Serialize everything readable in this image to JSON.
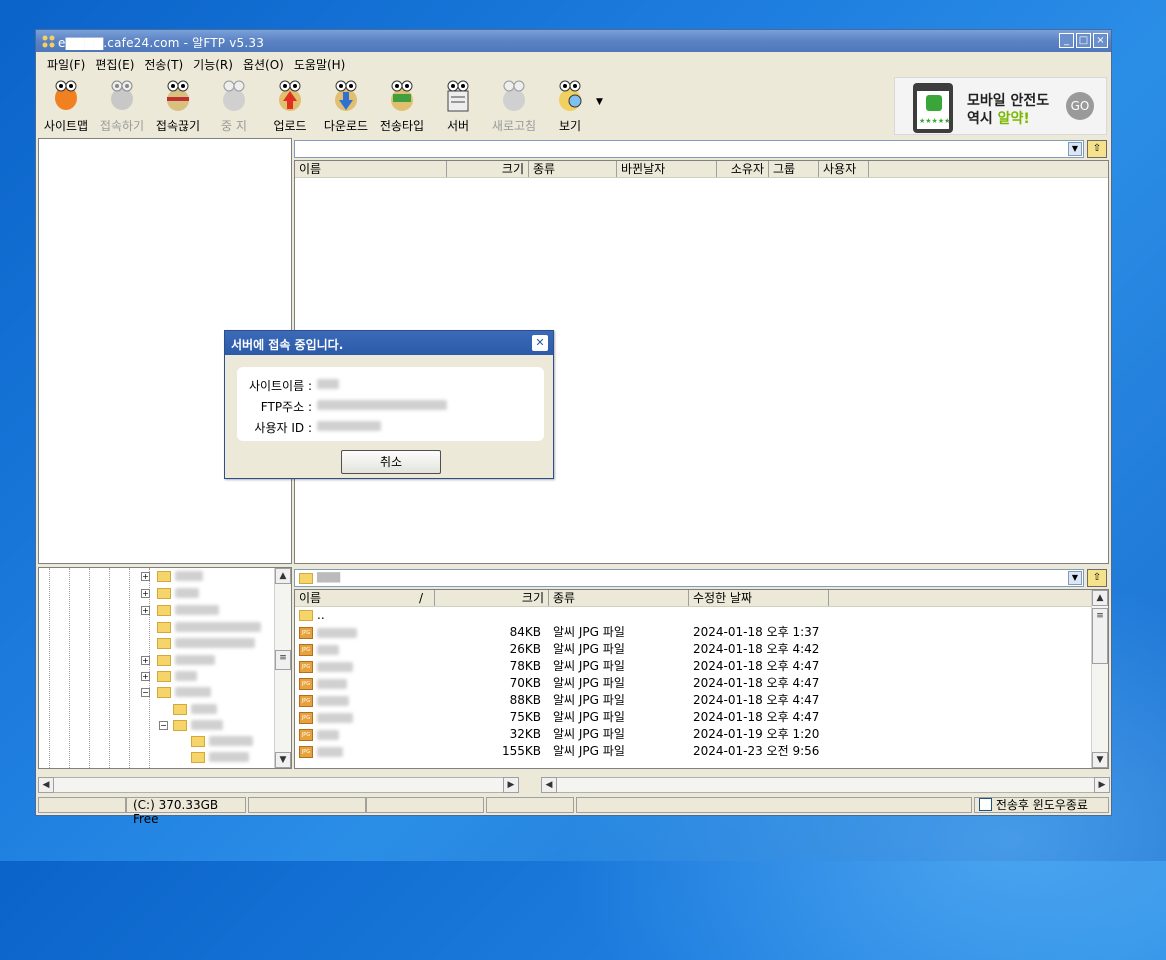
{
  "titlebar": {
    "title": "e▇▇▇▇.cafe24.com - 알FTP v5.33",
    "buttons": [
      "_",
      "□",
      "×"
    ]
  },
  "menu": [
    "파일(F)",
    "편집(E)",
    "전송(T)",
    "기능(R)",
    "옵션(O)",
    "도움말(H)"
  ],
  "toolbar": [
    {
      "label": "사이트맵",
      "icon": "sitemap-icon",
      "enabled": true
    },
    {
      "label": "접속하기",
      "icon": "connect-icon",
      "enabled": false
    },
    {
      "label": "접속끊기",
      "icon": "disconnect-icon",
      "enabled": true
    },
    {
      "label": "중 지",
      "icon": "stop-icon",
      "enabled": false
    },
    {
      "label": "업로드",
      "icon": "upload-icon",
      "enabled": true
    },
    {
      "label": "다운로드",
      "icon": "download-icon",
      "enabled": true
    },
    {
      "label": "전송타입",
      "icon": "transfer-type-icon",
      "enabled": true
    },
    {
      "label": "서버",
      "icon": "server-icon",
      "enabled": true
    },
    {
      "label": "새로고침",
      "icon": "refresh-icon",
      "enabled": false
    },
    {
      "label": "보기",
      "icon": "view-icon",
      "enabled": true
    }
  ],
  "ad": {
    "line1": "모바일 안전도",
    "line2_prefix": "역시 ",
    "line2_highlight": "알약!",
    "go": "GO"
  },
  "remote": {
    "columns": [
      "이름",
      "크기",
      "종류",
      "바뀐날자",
      "소유자",
      "그룹",
      "사용자"
    ]
  },
  "local": {
    "path": "▇▇▇",
    "columns": [
      "이름",
      "/",
      "크기",
      "종류",
      "수정한 날짜"
    ],
    "parent": "..",
    "files": [
      {
        "size": "84KB",
        "type": "알씨 JPG 파일",
        "date": "2024-01-18 오후 1:37"
      },
      {
        "size": "26KB",
        "type": "알씨 JPG 파일",
        "date": "2024-01-18 오후 4:42"
      },
      {
        "size": "78KB",
        "type": "알씨 JPG 파일",
        "date": "2024-01-18 오후 4:47"
      },
      {
        "size": "70KB",
        "type": "알씨 JPG 파일",
        "date": "2024-01-18 오후 4:47"
      },
      {
        "size": "88KB",
        "type": "알씨 JPG 파일",
        "date": "2024-01-18 오후 4:47"
      },
      {
        "size": "75KB",
        "type": "알씨 JPG 파일",
        "date": "2024-01-18 오후 4:47"
      },
      {
        "size": "32KB",
        "type": "알씨 JPG 파일",
        "date": "2024-01-19 오후 1:20"
      },
      {
        "size": "155KB",
        "type": "알씨 JPG 파일",
        "date": "2024-01-23 오전 9:56"
      }
    ]
  },
  "dialog": {
    "title": "서버에 접속 중입니다.",
    "site_label": "사이트이름 :",
    "ftp_label": "FTP주소 :",
    "user_label": "사용자 ID :",
    "cancel": "취소"
  },
  "status": {
    "drive": "(C:)  370.33GB Free",
    "checkbox_label": "전송후 윈도우종료"
  },
  "colors": {
    "titlebar": "#5b83c4",
    "dialog_title": "#2a5aa8",
    "accent_green": "#7ab800"
  }
}
